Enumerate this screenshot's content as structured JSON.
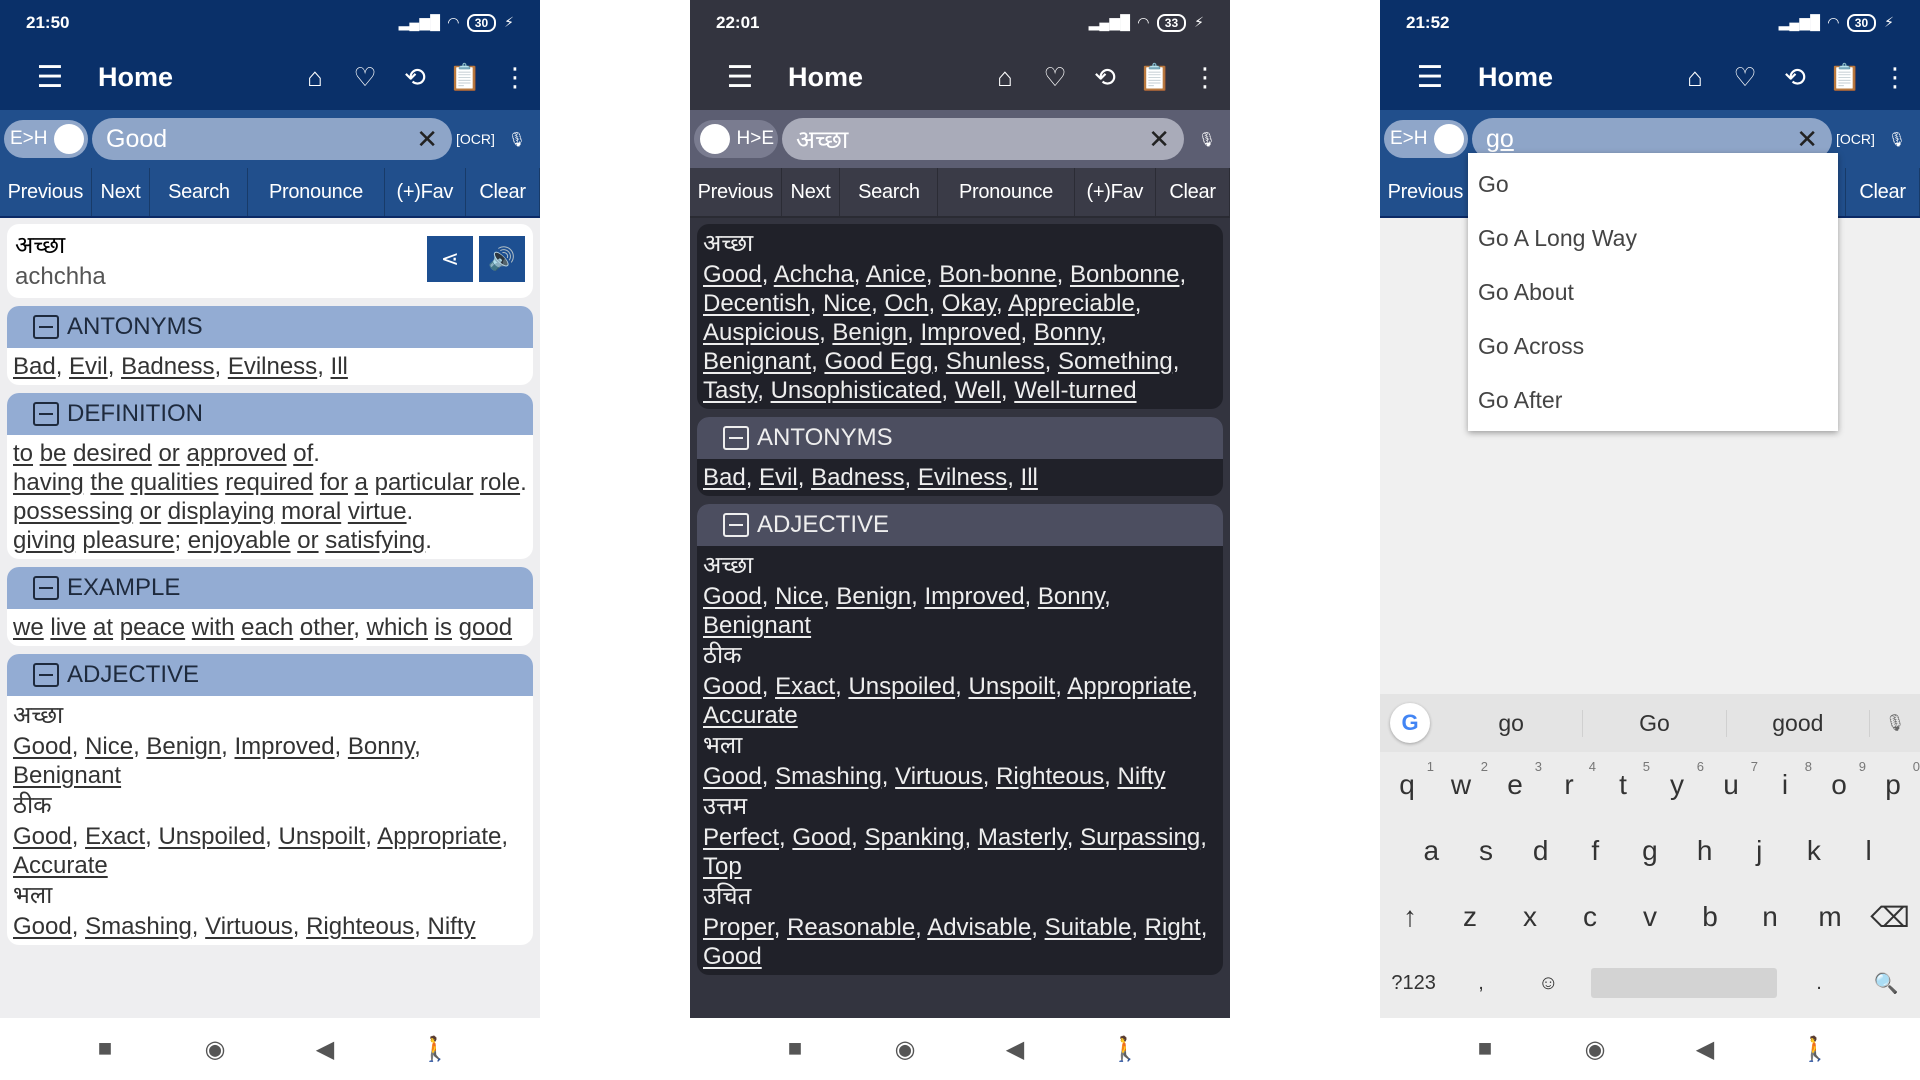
{
  "common": {
    "app_title": "Home",
    "buttons": [
      "Previous",
      "Next",
      "Search",
      "Pronounce",
      "(+)Fav",
      "Clear"
    ],
    "nav_icons": [
      "recents-square-icon",
      "home-circle-icon",
      "back-triangle-icon",
      "accessibility-icon"
    ]
  },
  "colors": {
    "primary": "#0a3069",
    "button_bar": "#214f8c",
    "section_header": "#93acd3",
    "dark_bg": "#33343f",
    "dark_card": "#202129"
  },
  "panel1": {
    "time": "21:50",
    "battery": "30",
    "toggle": "E>H",
    "search_value": "Good",
    "word": {
      "hindi": "अच्छा",
      "translit": "achchha"
    },
    "sections": [
      {
        "title": "ANTONYMS",
        "lists": [
          {
            "words": [
              "Bad",
              "Evil",
              "Badness",
              "Evilness",
              "Ill"
            ]
          }
        ]
      },
      {
        "title": "DEFINITION",
        "lines": [
          "to be desired or approved of.",
          "having the qualities required for a particular role.",
          "possessing or displaying moral virtue.",
          "giving pleasure; enjoyable or satisfying."
        ]
      },
      {
        "title": "EXAMPLE",
        "lines": [
          "we live at peace with each other, which is good"
        ]
      },
      {
        "title": "ADJECTIVE",
        "lists": [
          {
            "head": "अच्छा",
            "words": [
              "Good",
              "Nice",
              "Benign",
              "Improved",
              "Bonny",
              "Benignant"
            ]
          },
          {
            "head": "ठीक",
            "words": [
              "Good",
              "Exact",
              "Unspoiled",
              "Unspoilt",
              "Appropriate",
              "Accurate"
            ]
          },
          {
            "head": "भला",
            "words": [
              "Good",
              "Smashing",
              "Virtuous",
              "Righteous",
              "Nifty"
            ]
          }
        ]
      }
    ]
  },
  "panel2": {
    "time": "22:01",
    "battery": "33",
    "toggle": "H>E",
    "search_value": "अच्छा",
    "sections": [
      {
        "title": "",
        "lists": [
          {
            "head": "अच्छा",
            "words": [
              "Good",
              "Achcha",
              "Anice",
              "Bon-bonne",
              "Bonbonne",
              "Decentish",
              "Nice",
              "Och",
              "Okay",
              "Appreciable",
              "Auspicious",
              "Benign",
              "Improved",
              "Bonny",
              "Benignant",
              "Good Egg",
              "Shunless",
              "Something",
              "Tasty",
              "Unsophisticated",
              "Well",
              "Well-turned"
            ]
          }
        ]
      },
      {
        "title": "ANTONYMS",
        "lists": [
          {
            "words": [
              "Bad",
              "Evil",
              "Badness",
              "Evilness",
              "Ill"
            ]
          }
        ]
      },
      {
        "title": "ADJECTIVE",
        "lists": [
          {
            "head": "अच्छा",
            "words": [
              "Good",
              "Nice",
              "Benign",
              "Improved",
              "Bonny",
              "Benignant"
            ]
          },
          {
            "head": "ठीक",
            "words": [
              "Good",
              "Exact",
              "Unspoiled",
              "Unspoilt",
              "Appropriate",
              "Accurate"
            ]
          },
          {
            "head": "भला",
            "words": [
              "Good",
              "Smashing",
              "Virtuous",
              "Righteous",
              "Nifty"
            ]
          },
          {
            "head": "उत्तम",
            "words": [
              "Perfect",
              "Good",
              "Spanking",
              "Masterly",
              "Surpassing",
              "Top"
            ]
          },
          {
            "head": "उचित",
            "words": [
              "Proper",
              "Reasonable",
              "Advisable",
              "Suitable",
              "Right",
              "Good"
            ]
          }
        ]
      }
    ]
  },
  "panel3": {
    "time": "21:52",
    "battery": "30",
    "toggle": "E>H",
    "search_value": "go",
    "suggestions": [
      "Go",
      "Go A Long Way",
      "Go About",
      "Go Across",
      "Go After"
    ],
    "keyboard": {
      "suggestions": [
        "go",
        "Go",
        "good"
      ],
      "row1": [
        "q",
        "w",
        "e",
        "r",
        "t",
        "y",
        "u",
        "i",
        "o",
        "p"
      ],
      "row1_nums": [
        "1",
        "2",
        "3",
        "4",
        "5",
        "6",
        "7",
        "8",
        "9",
        "0"
      ],
      "row2": [
        "a",
        "s",
        "d",
        "f",
        "g",
        "h",
        "j",
        "k",
        "l"
      ],
      "row3": [
        "z",
        "x",
        "c",
        "v",
        "b",
        "n",
        "m"
      ],
      "symbols_key": "?123",
      "comma": ",",
      "period": "."
    }
  }
}
